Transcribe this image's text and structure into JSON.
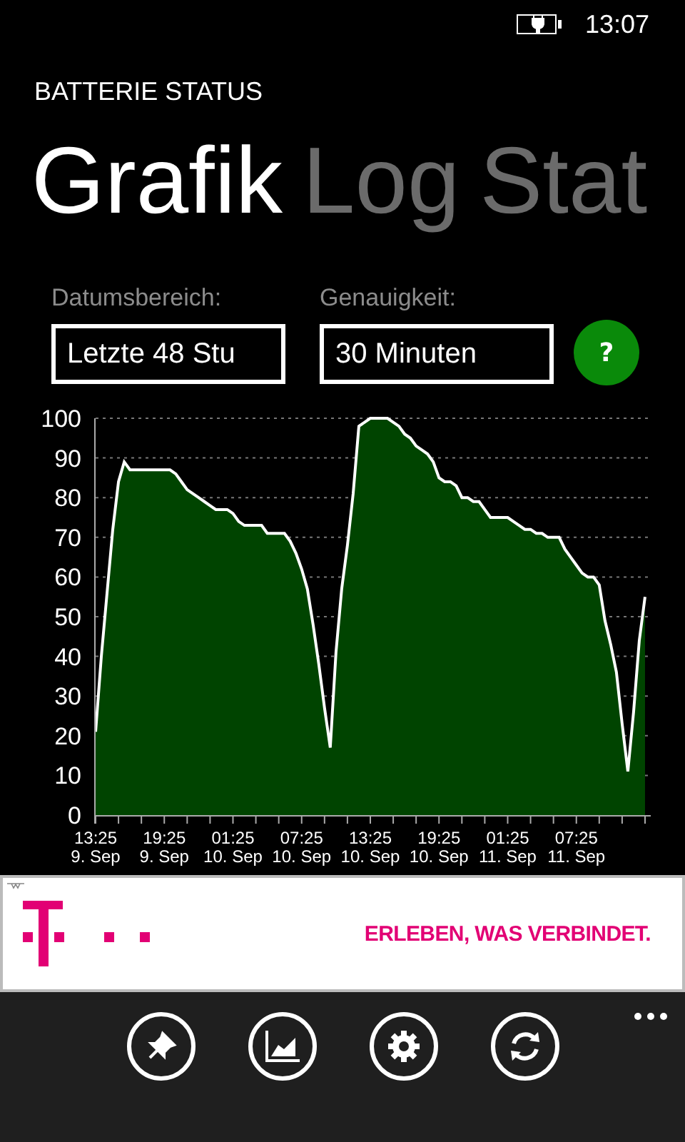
{
  "status_bar": {
    "time": "13:07"
  },
  "app_title": "BATTERIE STATUS",
  "pivot": [
    {
      "label": "Grafik",
      "selected": true
    },
    {
      "label": "Log",
      "selected": false
    },
    {
      "label": "Stat",
      "selected": false
    }
  ],
  "filters": [
    {
      "label": "Datumsbereich:",
      "value": "Letzte 48 Stu"
    },
    {
      "label": "Genauigkeit:",
      "value": "30 Minuten"
    }
  ],
  "help_button": "?",
  "chart": {
    "chart_data": {
      "type": "area",
      "grid": true,
      "ylim": [
        0,
        100
      ],
      "yticks": [
        0,
        10,
        20,
        30,
        40,
        50,
        60,
        70,
        80,
        90,
        100
      ],
      "categories": [
        "13:25 9. Sep",
        null,
        null,
        null,
        null,
        null,
        null,
        null,
        null,
        null,
        null,
        null,
        "19:25 9. Sep",
        null,
        null,
        null,
        null,
        null,
        null,
        null,
        null,
        null,
        null,
        null,
        "01:25 10. Sep",
        null,
        null,
        null,
        null,
        null,
        null,
        null,
        null,
        null,
        null,
        null,
        "07:25 10. Sep",
        null,
        null,
        null,
        null,
        null,
        null,
        null,
        null,
        null,
        null,
        null,
        "13:25 10. Sep",
        null,
        null,
        null,
        null,
        null,
        null,
        null,
        null,
        null,
        null,
        null,
        "19:25 10. Sep",
        null,
        null,
        null,
        null,
        null,
        null,
        null,
        null,
        null,
        null,
        null,
        "01:25 11. Sep",
        null,
        null,
        null,
        null,
        null,
        null,
        null,
        null,
        null,
        null,
        null,
        "07:25 11. Sep",
        null,
        null,
        null,
        null,
        null,
        null,
        null,
        null,
        null,
        null,
        null,
        null
      ],
      "series": [
        {
          "color": "#ffffff",
          "values": [
            21,
            40,
            56,
            72,
            84,
            89,
            87,
            87,
            87,
            87,
            87,
            87,
            87,
            87,
            86,
            84,
            82,
            81,
            80,
            79,
            78,
            77,
            77,
            77,
            76,
            74,
            73,
            73,
            73,
            73,
            71,
            71,
            71,
            71,
            69,
            66,
            62,
            57,
            48,
            38,
            27,
            17,
            41,
            57,
            68,
            81,
            98,
            99,
            100,
            100,
            100,
            100,
            99,
            98,
            96,
            95,
            93,
            92,
            91,
            89,
            85,
            84,
            84,
            83,
            80,
            80,
            79,
            79,
            77,
            75,
            75,
            75,
            75,
            74,
            73,
            72,
            72,
            71,
            71,
            70,
            70,
            70,
            67,
            65,
            63,
            61,
            60,
            60,
            58,
            49,
            43,
            36,
            23,
            11,
            26,
            44,
            55
          ]
        }
      ]
    }
  },
  "ad": {
    "slogan": "ERLEBEN, WAS VERBINDET."
  },
  "app_bar": {
    "buttons": [
      {
        "kind": "pin"
      },
      {
        "kind": "chart"
      },
      {
        "kind": "settings"
      },
      {
        "kind": "refresh"
      }
    ]
  }
}
